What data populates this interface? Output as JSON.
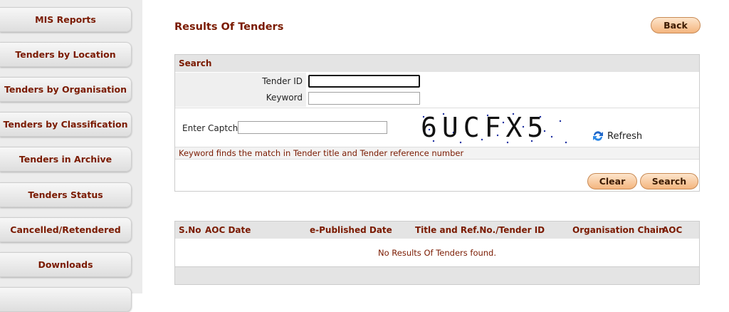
{
  "sidebar": {
    "items": [
      {
        "label": "MIS Reports"
      },
      {
        "label": "Tenders by Location"
      },
      {
        "label": "Tenders by Organisation"
      },
      {
        "label": "Tenders by Classification"
      },
      {
        "label": "Tenders in Archive"
      },
      {
        "label": "Tenders Status"
      },
      {
        "label": "Cancelled/Retendered"
      },
      {
        "label": "Downloads"
      }
    ]
  },
  "header": {
    "title": "Results Of Tenders",
    "back_label": "Back"
  },
  "search": {
    "heading": "Search",
    "tender_id_label": "Tender ID",
    "tender_id_value": "",
    "keyword_label": "Keyword",
    "keyword_value": "",
    "captcha_label": "Enter Captcha",
    "captcha_value": "",
    "captcha_text": "6UCFX5",
    "refresh_label": "Refresh",
    "hint": "Keyword finds the match in Tender title and Tender reference number",
    "clear_label": "Clear",
    "search_label": "Search"
  },
  "results": {
    "columns": [
      "S.No",
      "AOC Date",
      "e-Published Date",
      "Title and Ref.No./Tender ID",
      "Organisation Chain",
      "AOC"
    ],
    "empty_message": "No Results Of Tenders found."
  },
  "colors": {
    "accent": "#7a1a00",
    "button": "#f4b57e"
  }
}
